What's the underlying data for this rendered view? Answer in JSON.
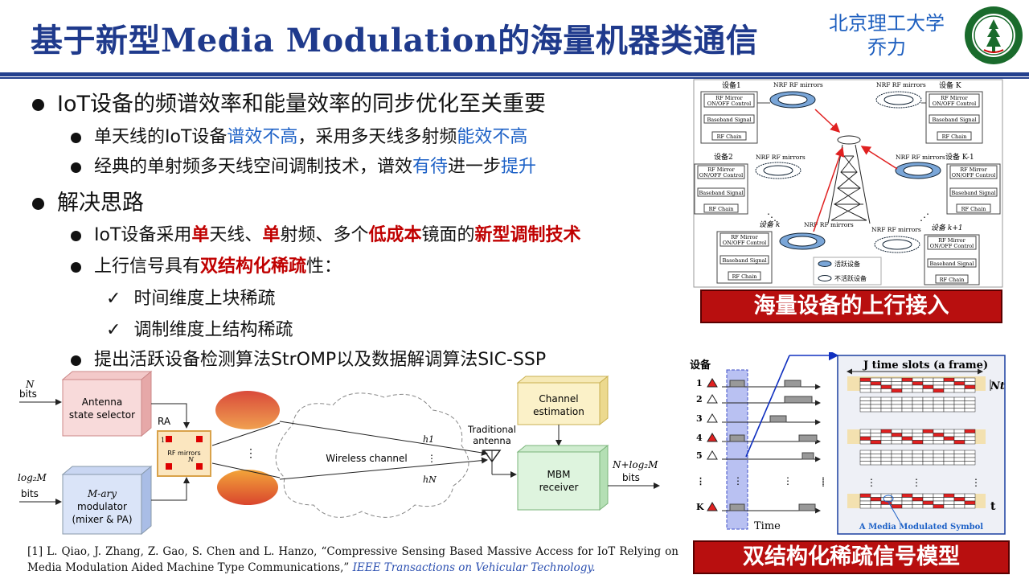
{
  "header": {
    "title": "基于新型Media Modulation的海量机器类通信",
    "university": "北京理工大学",
    "author": "乔力"
  },
  "bullets": {
    "b1": "IoT设备的频谱效率和能量效率的同步优化至关重要",
    "b1_1_a": "单天线的IoT设备",
    "b1_1_b": "谱效不高",
    "b1_1_c": "，采用多天线多射频",
    "b1_1_d": "能效不高",
    "b1_2_a": "经典的单射频多天线空间调制技术，谱效",
    "b1_2_b": "有待",
    "b1_2_c": "进一步",
    "b1_2_d": "提升",
    "b2": "解决思路",
    "b2_1_a": "IoT设备采用",
    "b2_1_b": "单",
    "b2_1_c": "天线、",
    "b2_1_d": "单",
    "b2_1_e": "射频、多个",
    "b2_1_f": "低成本",
    "b2_1_g": "镜面的",
    "b2_1_h": "新型调制技术",
    "b2_2_a": "上行信号具有",
    "b2_2_b": "双结构化稀疏",
    "b2_2_c": "性：",
    "b2_2_1": "时间维度上块稀疏",
    "b2_2_2": "调制维度上结构稀疏",
    "b2_3": "提出活跃设备检测算法StrOMP以及数据解调算法SIC-SSP"
  },
  "fig_system": {
    "in1_a": "N",
    "in1_b": "bits",
    "in2_a": "log₂M",
    "in2_b": "bits",
    "box_selector": "Antenna state selector",
    "box_selector_1": "Antenna",
    "box_selector_2": "state selector",
    "box_mod_1": "M-ary",
    "box_mod_2": "modulator",
    "box_mod_3": "(mixer & PA)",
    "ra_label": "RA",
    "rf_mirrors": "RF mirrors",
    "ra_one": "1",
    "ra_n": "N",
    "channel": "Wireless channel",
    "h1": "h1",
    "hn": "hN",
    "ant_1": "Traditional",
    "ant_2": "antenna",
    "chest_1": "Channel",
    "chest_2": "estimation",
    "rx_1": "MBM",
    "rx_2": "receiver",
    "out_1": "N+log₂M",
    "out_2": "bits"
  },
  "fig_access": {
    "dev1": "设备1",
    "devK": "设备 K",
    "dev2": "设备2",
    "devK1": "设备 K-1",
    "devk": "设备 k",
    "devkp1": "设备 k+1",
    "mirrors": "NRF RF mirrors",
    "rf_mirror_1": "RF Mirror",
    "rf_mirror_2": "ON/OFF Control",
    "baseband": "Baseband Signal",
    "rfchain": "RF Chain",
    "legend_active": "活跃设备",
    "legend_inactive": "不活跃设备",
    "banner": "海量设备的上行接入"
  },
  "fig_sparse": {
    "dev_label": "设备",
    "rows": [
      "1",
      "2",
      "3",
      "4",
      "5",
      "⋮",
      "K"
    ],
    "time": "Time",
    "frame": "J time slots (a frame)",
    "nt": "Nt",
    "t": "t",
    "symbol": "A Media Modulated Symbol",
    "banner": "双结构化稀疏信号模型"
  },
  "reference": {
    "text": "[1] L. Qiao, J. Zhang, Z. Gao, S. Chen and L. Hanzo, “Compressive Sensing Based Massive Access for IoT Relying on Media Modulation Aided Machine Type Communications,” ",
    "journal": "IEEE Transactions on Vehicular Technology."
  },
  "colors": {
    "title": "#1f3a8c",
    "accent_blue": "#1e62c7",
    "accent_red": "#c00000",
    "banner": "#b80f0f",
    "logo": "#1a6b2c"
  }
}
